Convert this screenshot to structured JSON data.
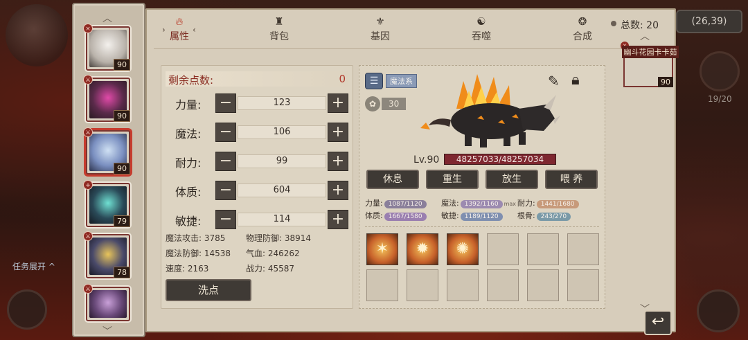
{
  "background": {
    "task_toggle_label": "任务展开 ^",
    "coordinates": "(26,39)",
    "roster_progress": "19/20"
  },
  "roster": {
    "cards": [
      {
        "level": "90",
        "mark": "×"
      },
      {
        "level": "90",
        "mark": "⚔"
      },
      {
        "level": "90",
        "mark": "⚔"
      },
      {
        "level": "79",
        "mark": "+"
      },
      {
        "level": "78",
        "mark": "⚔"
      },
      {
        "level": "",
        "mark": "⚔"
      }
    ],
    "selected_index": 2
  },
  "tabs": [
    {
      "label": "属性",
      "icon": "flame-icon",
      "active": true
    },
    {
      "label": "背包",
      "icon": "bag-icon",
      "active": false
    },
    {
      "label": "基因",
      "icon": "gene-icon",
      "active": false
    },
    {
      "label": "吞噬",
      "icon": "devour-icon",
      "active": false
    },
    {
      "label": "合成",
      "icon": "compose-icon",
      "active": false
    }
  ],
  "attributes": {
    "remaining_label": "剩余点数:",
    "remaining_value": "0",
    "stats": [
      {
        "label": "力量:",
        "value": "123"
      },
      {
        "label": "魔法:",
        "value": "106"
      },
      {
        "label": "耐力:",
        "value": "99"
      },
      {
        "label": "体质:",
        "value": "604"
      },
      {
        "label": "敏捷:",
        "value": "114"
      }
    ],
    "derived": {
      "magic_attack": "魔法攻击: 3785",
      "physical_defense": "物理防御: 38914",
      "magic_defense": "魔法防御: 14538",
      "hp": "气血: 246262",
      "speed": "速度: 2163",
      "power": "战力: 45587"
    },
    "wash_label": "洗点"
  },
  "pet": {
    "type_tag": "魔法系",
    "rank_value": "30",
    "level": "Lv.90",
    "hp_text": "48257033/48257034",
    "actions": [
      "休息",
      "重生",
      "放生",
      "喂 养"
    ],
    "growth": {
      "str": {
        "label": "力量:",
        "value": "1087/1120",
        "color": "#8a7f9a"
      },
      "mag": {
        "label": "魔法:",
        "value": "1392/1160",
        "color": "#9c8ab0",
        "suffix": "max"
      },
      "sta": {
        "label": "耐力:",
        "value": "1441/1680",
        "color": "#c79a7a"
      },
      "con": {
        "label": "体质:",
        "value": "1667/1580",
        "color": "#9a7fb0"
      },
      "agi": {
        "label": "敏捷:",
        "value": "1189/1120",
        "color": "#7f8fb0"
      },
      "bone": {
        "label": "根骨:",
        "value": "243/270",
        "color": "#7a9aa8"
      }
    }
  },
  "side": {
    "total_label": "总数: 20",
    "card_name": "幽斗花园卡卡茹",
    "card_level": "90"
  },
  "colors": {
    "panel": "#d7cdbb",
    "accent_red": "#b13a2c",
    "button_dark": "#3e3934"
  }
}
